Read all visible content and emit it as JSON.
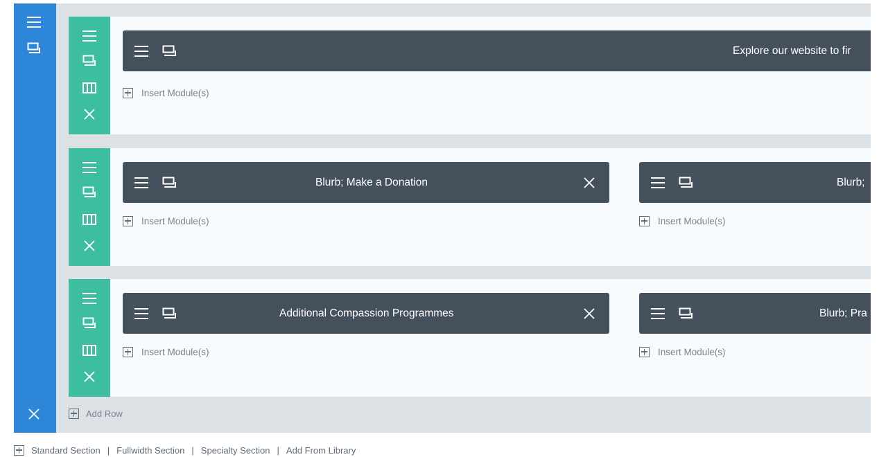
{
  "section": {
    "add_row_label": "Add Row"
  },
  "rows": [
    {
      "modules": [
        {
          "title": "Explore our website to fir",
          "closable": false
        }
      ],
      "insert_label": "Insert Module(s)"
    },
    {
      "modules": [
        {
          "title": "Blurb; Make a Donation",
          "closable": true
        },
        {
          "title": "Blurb;",
          "closable": false
        }
      ],
      "insert_label": "Insert Module(s)"
    },
    {
      "modules": [
        {
          "title": "Additional Compassion Programmes",
          "closable": true
        },
        {
          "title": "Blurb; Pra",
          "closable": false
        }
      ],
      "insert_label": "Insert Module(s)"
    }
  ],
  "footer": {
    "standard_section": "Standard Section",
    "fullwidth_section": "Fullwidth Section",
    "specialty_section": "Specialty Section",
    "add_from_library": "Add From Library",
    "separator": "|"
  },
  "colors": {
    "section_bar": "#2e86d9",
    "row_handle": "#3ebea0",
    "module_bg": "#45505d",
    "section_bg": "#dce1e5"
  }
}
